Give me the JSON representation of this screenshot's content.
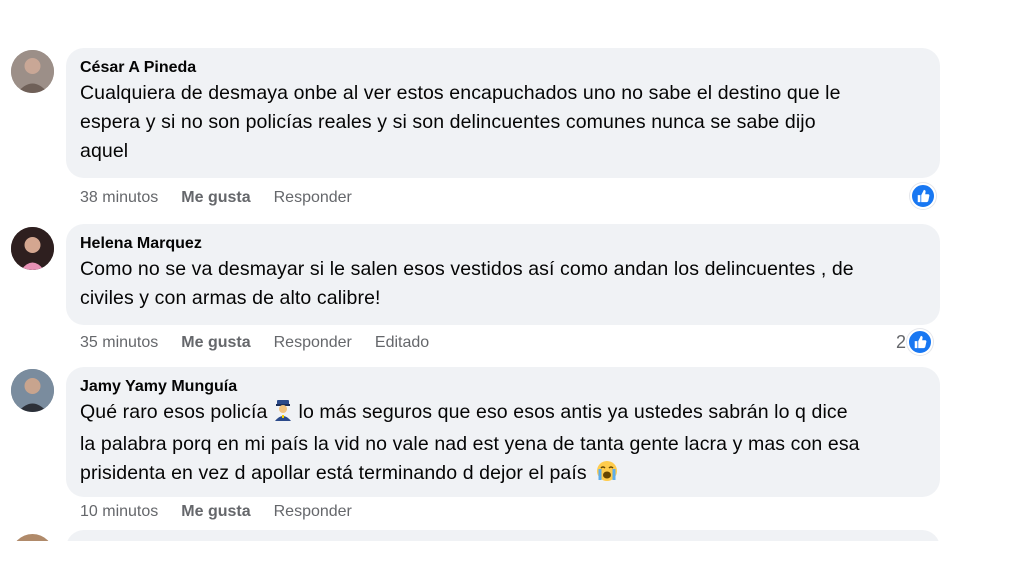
{
  "comments": [
    {
      "author": "César A Pineda",
      "lines": [
        "Cualquiera de desmaya onbe al ver estos encapuchados uno no sabe el destino que le",
        "espera y si no son policías reales y si son delincuentes comunes nunca se sabe dijo",
        "aquel"
      ],
      "time": "38 minutos",
      "like_label": "Me gusta",
      "reply_label": "Responder",
      "reaction_count": ""
    },
    {
      "author": "Helena Marquez",
      "lines": [
        "Como no se va desmayar si le salen esos vestidos así como andan los delincuentes , de",
        "civiles y con armas de alto calibre!"
      ],
      "time": "35 minutos",
      "like_label": "Me gusta",
      "reply_label": "Responder",
      "edited_label": "Editado",
      "reaction_count": "2"
    },
    {
      "author": "Jamy Yamy Munguía",
      "line1_before": "Qué raro esos policía",
      "line1_after": " lo más seguros que eso esos antis ya ustedes sabrán lo q dice",
      "line2": "la palabra porq en mi país la vid no vale nad est yena de tanta gente lacra y mas con esa",
      "line3": "prisidenta en vez d apollar está terminando d dejor el país",
      "time": "10 minutos",
      "like_label": "Me gusta",
      "reply_label": "Responder"
    }
  ],
  "icons": {
    "like_reaction": "thumbs-up-icon",
    "police_emoji": "police-officer-emoji",
    "crying_emoji": "loudly-crying-face-emoji"
  },
  "colors": {
    "bubble": "#f0f2f5",
    "meta_text": "#65676b",
    "like_blue": "#1877f2"
  }
}
